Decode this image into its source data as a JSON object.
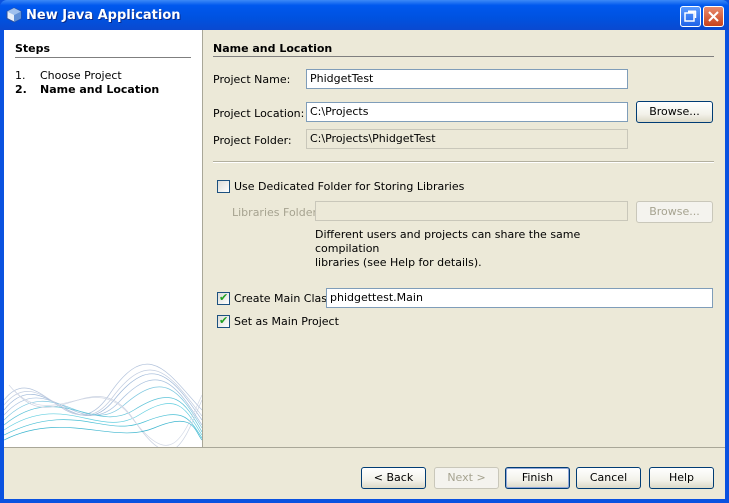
{
  "window": {
    "title": "New Java Application",
    "icon": "java-app-icon"
  },
  "steps": {
    "heading": "Steps",
    "items": [
      {
        "num": "1.",
        "label": "Choose Project",
        "current": false
      },
      {
        "num": "2.",
        "label": "Name and Location",
        "current": true
      }
    ]
  },
  "section": {
    "title": "Name and Location"
  },
  "project_name": {
    "label": "Project Name:",
    "value": "PhidgetTest"
  },
  "project_location": {
    "label": "Project Location:",
    "value": "C:\\Projects",
    "browse": "Browse..."
  },
  "project_folder": {
    "label": "Project Folder:",
    "value": "C:\\Projects\\PhidgetTest"
  },
  "libraries": {
    "checkbox_label": "Use Dedicated Folder for Storing Libraries",
    "checked": false,
    "folder_label": "Libraries Folder:",
    "folder_value": "",
    "browse": "Browse...",
    "note": "Different users and projects can share the same compilation\nlibraries (see Help for details)."
  },
  "main_class": {
    "checkbox_label": "Create Main Class",
    "checked": true,
    "value": "phidgettest.Main"
  },
  "main_project": {
    "checkbox_label": "Set as Main Project",
    "checked": true
  },
  "buttons": {
    "back": "< Back",
    "next": "Next >",
    "finish": "Finish",
    "cancel": "Cancel",
    "help": "Help"
  }
}
